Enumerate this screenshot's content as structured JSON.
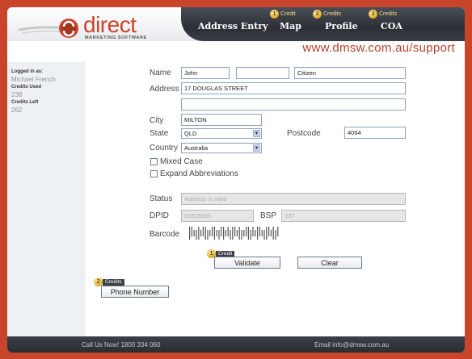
{
  "brand": {
    "name": "direct",
    "tagline": "MARKETING SOFTWARE",
    "accent_color": "#c8452b"
  },
  "nav": {
    "items": [
      {
        "label": "Address Entry",
        "credit_count": null,
        "credit_label": null
      },
      {
        "label": "Map",
        "credit_count": "1",
        "credit_label": "Credit"
      },
      {
        "label": "Profile",
        "credit_count": "3",
        "credit_label": "Credits"
      },
      {
        "label": "COA",
        "credit_count": "3",
        "credit_label": "Credits"
      }
    ]
  },
  "support_url": "www.dmsw.com.au/support",
  "sidebar": {
    "logged_in_label": "Logged in as:",
    "user_name": "Michael French",
    "credits_used_label": "Credits Used",
    "credits_used": "238",
    "credits_left_label": "Credits Left",
    "credits_left": "262"
  },
  "form": {
    "name_label": "Name",
    "first_name": "John",
    "middle_name": "",
    "last_name": "Citizen",
    "address_label": "Address",
    "address_line1": "17 DOUGLAS STREET",
    "address_line2": "",
    "city_label": "City",
    "city": "MILTON",
    "state_label": "State",
    "state": "QLD",
    "postcode_label": "Postcode",
    "postcode": "4064",
    "country_label": "Country",
    "country": "Australia",
    "mixed_case_label": "Mixed Case",
    "expand_abbrev_label": "Expand Abbreviations",
    "status_label": "Status",
    "status_value": "Address is valid",
    "dpid_label": "DPID",
    "dpid_value": "61825695",
    "bsp_label": "BSP",
    "bsp_value": "037",
    "barcode_label": "Barcode"
  },
  "buttons": {
    "validate": "Validate",
    "validate_credit_count": "1",
    "validate_credit_label": "Credit",
    "clear": "Clear",
    "phone_number": "Phone Number",
    "phone_credit_count": "2",
    "phone_credit_label": "Credits"
  },
  "footer": {
    "call": "Call Us Now! 1800 334 060",
    "email": "Email info@dmsw.com.au"
  }
}
